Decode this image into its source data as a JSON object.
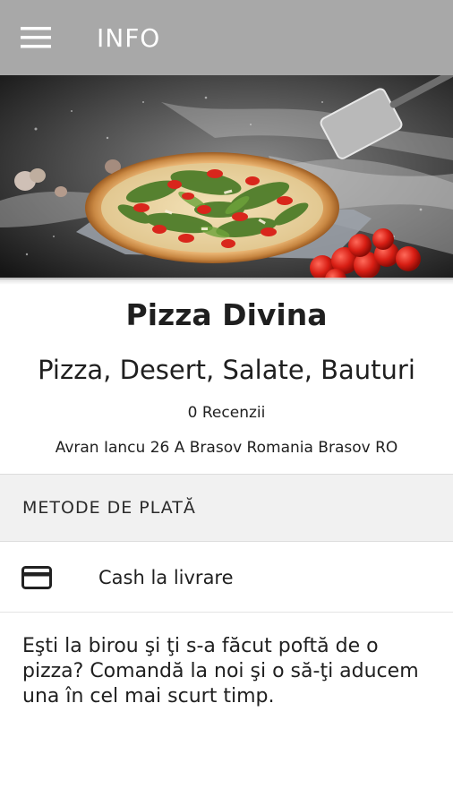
{
  "appbar": {
    "title": "INFO",
    "menu_icon": "hamburger-menu-icon",
    "background": "#a8a8a8"
  },
  "hero": {
    "image": "pizza-photo"
  },
  "restaurant": {
    "name": "Pizza Divina",
    "cuisines": "Pizza, Desert, Salate, Bauturi",
    "reviews": "0 Recenzii",
    "address": "Avran Iancu 26 A Brasov Romania Brasov RO"
  },
  "payment": {
    "section_title": "METODE DE PLATĂ",
    "methods": [
      {
        "icon": "credit-card-icon",
        "label": "Cash la livrare"
      }
    ]
  },
  "description": "Eşti la birou şi ţi s-a făcut poftă de o pizza? Comandă la noi şi o să-ţi aducem una în cel mai scurt timp."
}
